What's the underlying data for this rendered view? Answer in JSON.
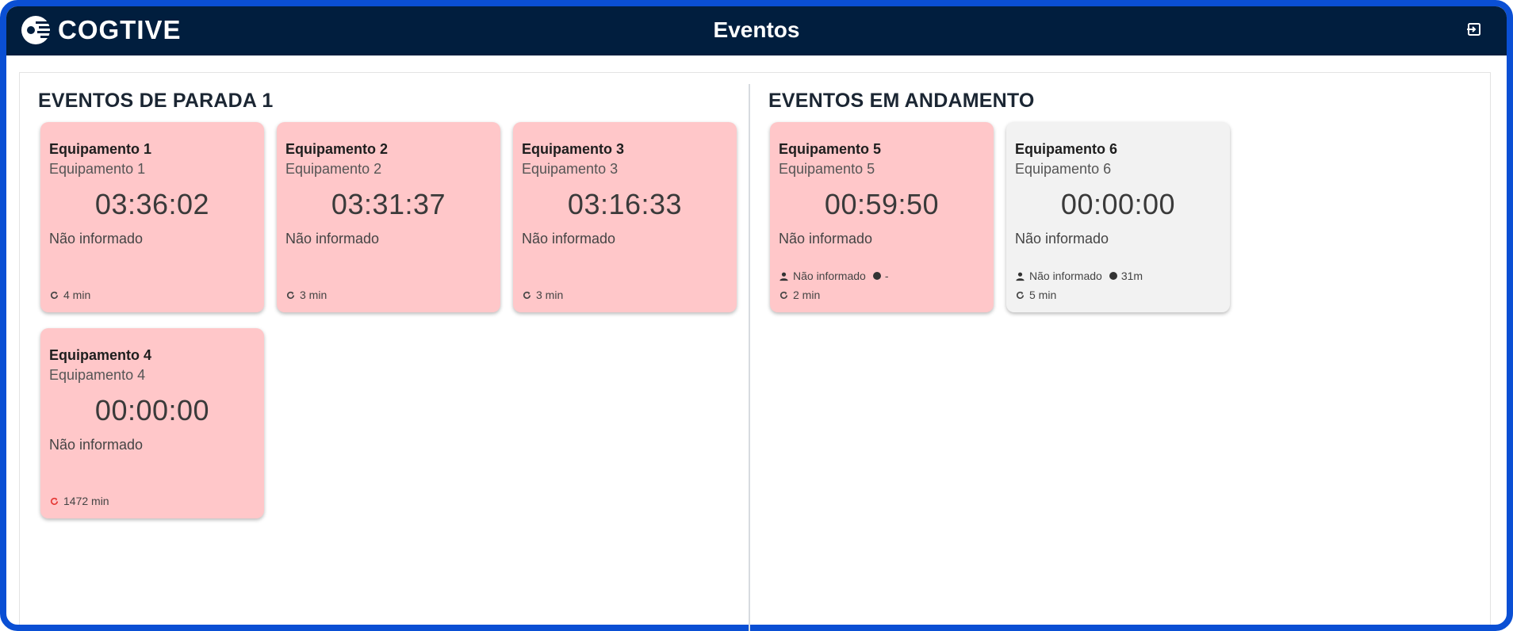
{
  "header": {
    "logo_text": "COGTIVE",
    "title": "Eventos"
  },
  "sections": [
    {
      "title": "EVENTOS DE PARADA 1"
    },
    {
      "title": "EVENTOS EM ANDAMENTO"
    }
  ],
  "cards": [
    {
      "title": "Equipamento 1",
      "subtitle": "Equipamento 1",
      "timer": "03:36:02",
      "status": "Não informado",
      "refresh": "4 min",
      "state": "alarm"
    },
    {
      "title": "Equipamento 2",
      "subtitle": "Equipamento 2",
      "timer": "03:31:37",
      "status": "Não informado",
      "refresh": "3 min",
      "state": "alarm"
    },
    {
      "title": "Equipamento 3",
      "subtitle": "Equipamento 3",
      "timer": "03:16:33",
      "status": "Não informado",
      "refresh": "3 min",
      "state": "alarm"
    },
    {
      "title": "Equipamento 4",
      "subtitle": "Equipamento 4",
      "timer": "00:00:00",
      "status": "Não informado",
      "refresh": "1472 min",
      "state": "alarm",
      "refresh_alert": true
    },
    {
      "title": "Equipamento 5",
      "subtitle": "Equipamento 5",
      "timer": "00:59:50",
      "status": "Não informado",
      "operator": "Não informado",
      "duration": "-",
      "refresh": "2 min",
      "state": "alarm"
    },
    {
      "title": "Equipamento 6",
      "subtitle": "Equipamento 6",
      "timer": "00:00:00",
      "status": "Não informado",
      "operator": "Não informado",
      "duration": "31m",
      "refresh": "5 min",
      "state": "normal"
    }
  ],
  "colors": {
    "header_bg": "#011e3e",
    "frame_border": "#0a4fd4",
    "card_alarm": "#ffc7c9",
    "card_normal": "#f2f2f2",
    "refresh_alert": "#e53935"
  }
}
